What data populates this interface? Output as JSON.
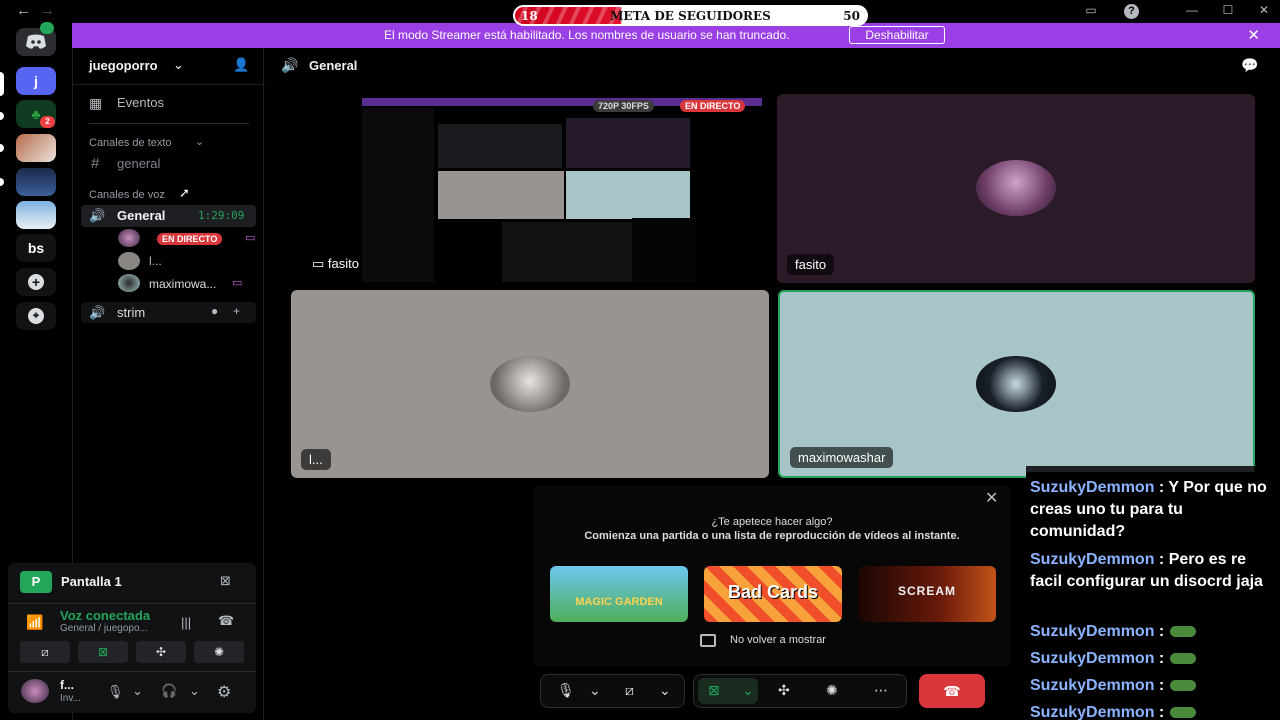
{
  "window": {
    "back": "←",
    "forward": "→",
    "inbox": "▭",
    "help": "?",
    "minimize": "—",
    "maximize": "☐",
    "close": "✕"
  },
  "meter": {
    "left": "18",
    "title": "META DE SEGUIDORES",
    "right": "50",
    "progress_fraction": 0.33
  },
  "banner": {
    "text": "El modo Streamer está habilitado. Los nombres de usuario se han truncado.",
    "button": "Deshabilitar",
    "close": "✕"
  },
  "rail": {
    "servers": [
      "j",
      "bs"
    ],
    "badge": "2",
    "add": "+",
    "discover": "⌖"
  },
  "sidebar": {
    "server_name": "juegoporro",
    "events": "Eventos",
    "text_category": "Canales de texto",
    "text_channel": "general",
    "voice_category": "Canales de voz",
    "voice_general": "General",
    "voice_timer": "1:29:09",
    "members": [
      {
        "name": "",
        "live": "EN DIRECTO"
      },
      {
        "name": "l..."
      },
      {
        "name": "maximowa..."
      }
    ],
    "voice_strim": "strim"
  },
  "userpanel": {
    "stream_label": "Pantalla 1",
    "voice_status": "Voz conectada",
    "voice_location": "General / juegopo...",
    "user_name": "f...",
    "user_status": "Inv..."
  },
  "main": {
    "channel": "General",
    "tiles": [
      {
        "name": "fasito",
        "overlay": "720P 30FPS",
        "live": "EN DIRECTO"
      },
      {
        "name": "fasito"
      },
      {
        "name": "l..."
      },
      {
        "name": "maximowashar"
      }
    ]
  },
  "activity": {
    "title": "¿Te apetece hacer algo?",
    "subtitle": "Comienza una partida o una lista de reproducción de vídeos al instante.",
    "games": [
      "MAGIC GARDEN",
      "Bad Cards",
      "SCREAM"
    ],
    "dont_show": "No volver a mostrar",
    "close": "✕"
  },
  "chat": [
    {
      "user": "SuzukyDemmon",
      "text": ": Y Por que no creas uno tu para tu comunidad?"
    },
    {
      "user": "SuzukyDemmon",
      "text": ": Pero es re facil configurar un disocrd jaja"
    },
    {
      "user": "SuzukyDemmon",
      "text": ":"
    },
    {
      "user": "SuzukyDemmon",
      "text": ":"
    },
    {
      "user": "SuzukyDemmon",
      "text": ":"
    },
    {
      "user": "SuzukyDemmon",
      "text": ":"
    }
  ],
  "colors": {
    "accent": "#9a3ee6",
    "live": "#da373c",
    "connected": "#23a55a",
    "hangup": "#da373c"
  }
}
